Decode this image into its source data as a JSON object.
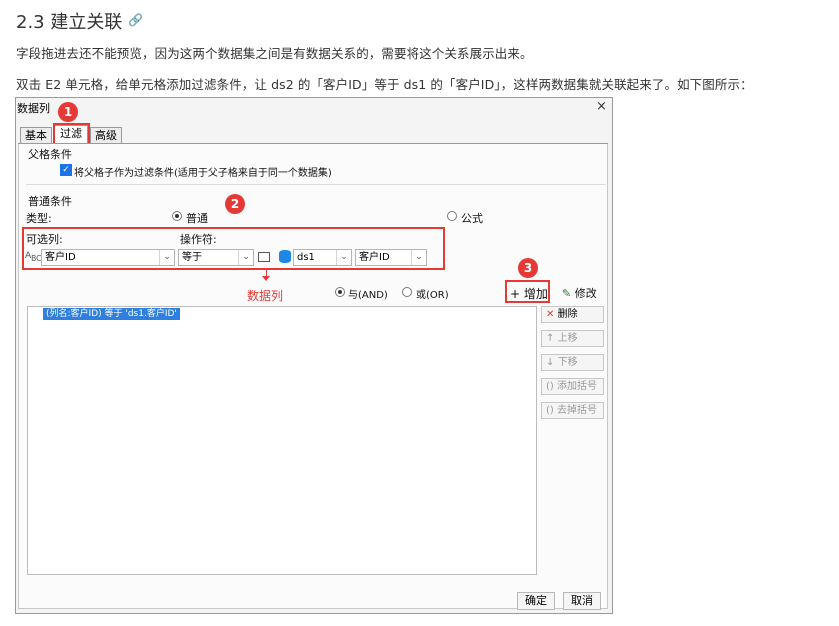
{
  "doc": {
    "heading": "2.3 建立关联",
    "link_icon": "link-icon",
    "para1": "字段拖进去还不能预览，因为这两个数据集之间是有数据关系的，需要将这个关系展示出来。",
    "para2": "双击 E2 单元格，给单元格添加过滤条件，让 ds2 的「客户ID」等于 ds1 的「客户ID」，这样两数据集就关联起来了。如下图所示："
  },
  "dialog": {
    "title": "数据列",
    "close_glyph": "×",
    "tabs": [
      "基本",
      "过滤",
      "高级"
    ],
    "active_tab": "过滤",
    "parent_section": "父格条件",
    "parent_checkbox_label": "将父格子作为过滤条件(适用于父子格来自于同一个数据集)",
    "parent_checkbox_checked": true,
    "normal_section": "普通条件",
    "type_label": "类型:",
    "type_options": [
      "普通",
      "公式"
    ],
    "type_selected": "普通",
    "col_label": "可选列:",
    "op_label": "操作符:",
    "col_value": "客户ID",
    "op_value": "等于",
    "ds_value": "ds1",
    "field_value": "客户ID",
    "annotation_label": "数据列",
    "logic_options": [
      "与(AND)",
      "或(OR)"
    ],
    "logic_selected": "与(AND)",
    "add_button": "增加",
    "modify_button": "修改",
    "condition_row": "(列名:客户ID) 等于 'ds1.客户ID'",
    "side_buttons": [
      "删除",
      "上移",
      "下移",
      "添加括号",
      "去掉括号"
    ],
    "ok_button": "确定",
    "cancel_button": "取消",
    "badges": [
      "1",
      "2",
      "3"
    ]
  },
  "colors": {
    "accent": "#e53935",
    "selection": "#2f7fe0"
  }
}
